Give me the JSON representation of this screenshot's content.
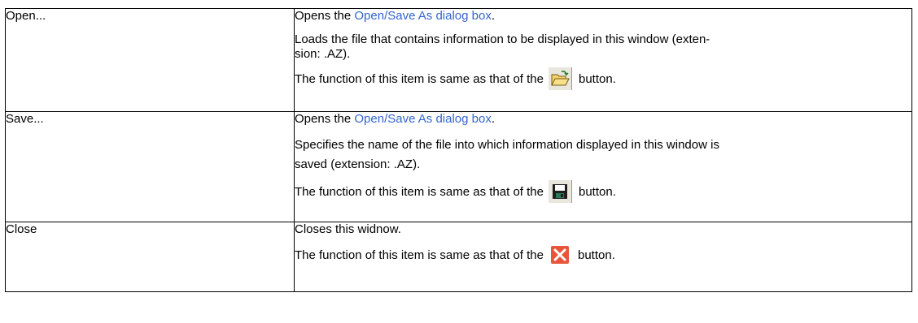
{
  "rows": [
    {
      "item": "Open...",
      "opens_prefix": "Opens the ",
      "opens_link": "Open/Save As dialog box",
      "opens_suffix": ".",
      "detail_1": "Loads the file that contains information to be displayed in this window (exten-",
      "detail_2": "sion: .AZ).",
      "function_prefix": "The function of this item is same as that of the",
      "function_suffix": "button.",
      "icon": "open-folder-icon"
    },
    {
      "item": "Save...",
      "opens_prefix": "Opens the ",
      "opens_link": "Open/Save As dialog box",
      "opens_suffix": ".",
      "detail_1": "Specifies the name of the file into which information displayed in this window is",
      "detail_2": "saved (extension: .AZ).",
      "function_prefix": "The function of this item is same as that of the",
      "function_suffix": "button.",
      "icon": "floppy-disk-icon"
    },
    {
      "item": "Close",
      "detail_1": "Closes this widnow.",
      "function_prefix": "The function of this item is same as that of the",
      "function_suffix": "button.",
      "icon": "close-x-icon"
    }
  ],
  "colors": {
    "link": "#3366cc",
    "border": "#000000",
    "icon_button_bg": "#e8e6dd",
    "close_red": "#e9553a"
  }
}
